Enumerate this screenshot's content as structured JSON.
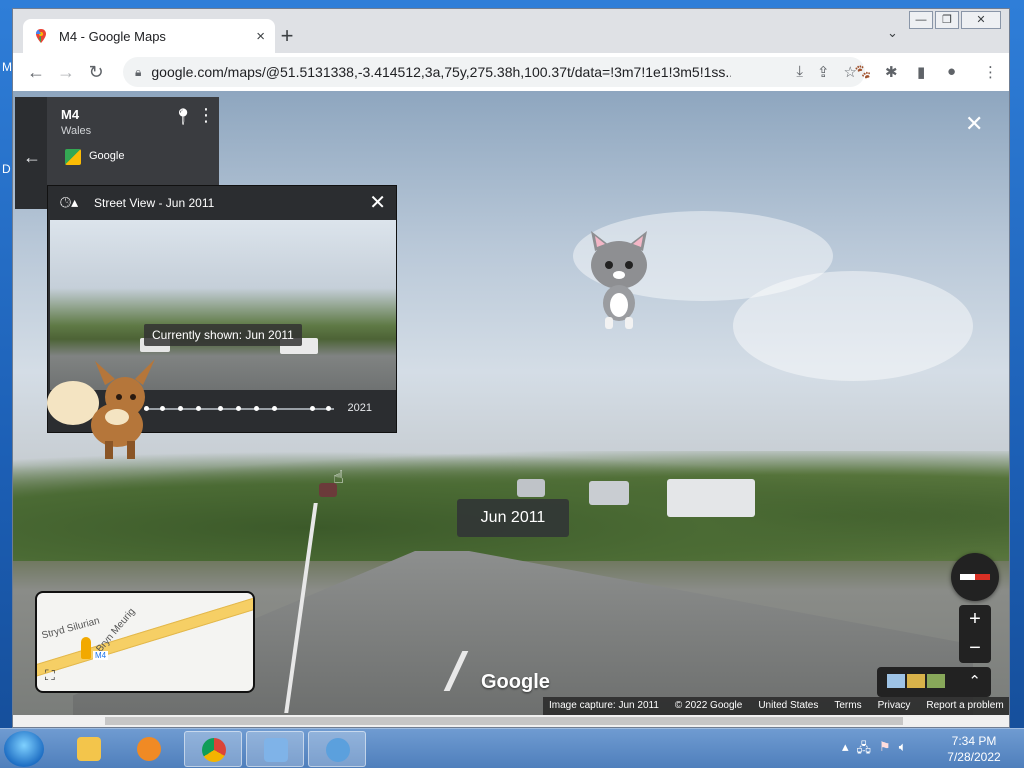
{
  "desktop": {
    "frag_top": "M",
    "frag_mid": "D"
  },
  "browser": {
    "tab_title": "M4 - Google Maps",
    "new_tab": "+",
    "tab_close": "×",
    "url": "google.com/maps/@51.5131338,-3.414512,3a,75y,275.38h,100.37t/data=!3m7!1e1!3m5!1ss...",
    "window_controls": {
      "minimize": "—",
      "restore": "❐",
      "close": "✕"
    }
  },
  "infocard": {
    "name": "M4",
    "region": "Wales",
    "source": "Google"
  },
  "time_machine": {
    "title": "Street View - Jun 2011",
    "currently_shown": "Currently shown: Jun 2011",
    "end_year": "2021"
  },
  "streetview": {
    "date_badge": "Jun 2011",
    "watermark": "Google"
  },
  "minimap": {
    "label_1": "Stryd Silurian",
    "label_2": "Bryn Meurig",
    "label_3": "M4"
  },
  "footer": {
    "capture": "Image capture: Jun 2011",
    "copyright": "© 2022 Google",
    "country": "United States",
    "terms": "Terms",
    "privacy": "Privacy",
    "report": "Report a problem"
  },
  "taskbar": {
    "time": "7:34 PM",
    "date": "7/28/2022"
  },
  "colors": {
    "accent_red": "#d93025",
    "panel_dark": "#2b2d30",
    "taskbar": "#4f7fbc"
  }
}
